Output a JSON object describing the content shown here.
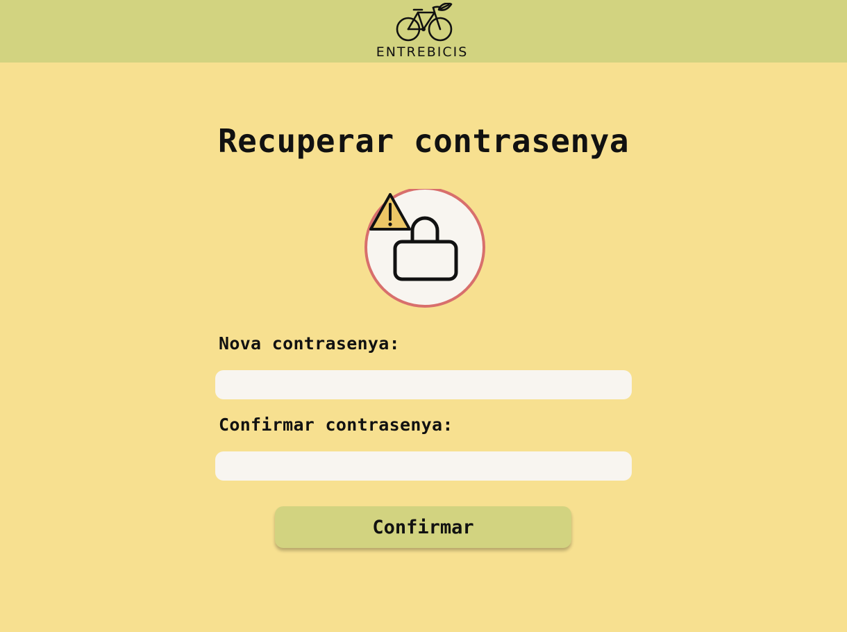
{
  "brand": {
    "name": "ENTREBICIS",
    "logo_icon": "bicycle-leaf-icon",
    "header_color": "#d2d380"
  },
  "page": {
    "title": "Recuperar contrasenya",
    "background_color": "#f7e090",
    "illustration_icon": "warning-padlock-icon"
  },
  "form": {
    "new_password_label": "Nova contrasenya:",
    "new_password_value": "",
    "confirm_password_label": "Confirmar contrasenya:",
    "confirm_password_value": "",
    "submit_label": "Confirmar"
  }
}
